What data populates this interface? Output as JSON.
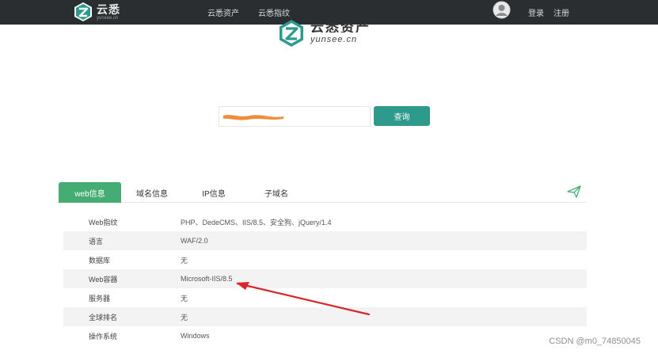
{
  "colors": {
    "accent": "#2e9a8c",
    "tab_active": "#45ad73",
    "topbar": "#2b2e30",
    "annotation_arrow": "#d8262a",
    "redaction": "#f08c3a"
  },
  "topbar": {
    "brand": {
      "name": "云悉",
      "sub": "yunsee.cn",
      "icon": "yunsee-logo"
    },
    "nav": [
      "云悉资产",
      "云悉指纹"
    ],
    "avatar_icon": "user-avatar-icon",
    "login": "登录",
    "register": "注册"
  },
  "hero": {
    "name": "云悉资产",
    "sub": "yunsee.cn"
  },
  "search": {
    "value": "",
    "redacted": true,
    "button": "查询"
  },
  "tabs": [
    {
      "label": "web信息",
      "active": true
    },
    {
      "label": "域名信息",
      "active": false
    },
    {
      "label": "IP信息",
      "active": false
    },
    {
      "label": "子域名",
      "active": false
    }
  ],
  "share_icon": "paper-plane-icon",
  "info_rows": [
    {
      "key": "Web指纹",
      "value": "PHP、DedeCMS、IIS/8.5、安全狗、jQuery/1.4"
    },
    {
      "key": "语言",
      "value": "WAF/2.0"
    },
    {
      "key": "数据库",
      "value": "无"
    },
    {
      "key": "Web容器",
      "value": "Microsoft-IIS/8.5"
    },
    {
      "key": "服务器",
      "value": "无"
    },
    {
      "key": "全球排名",
      "value": "无"
    },
    {
      "key": "操作系统",
      "value": "Windows"
    }
  ],
  "watermark": "CSDN @m0_74850045"
}
